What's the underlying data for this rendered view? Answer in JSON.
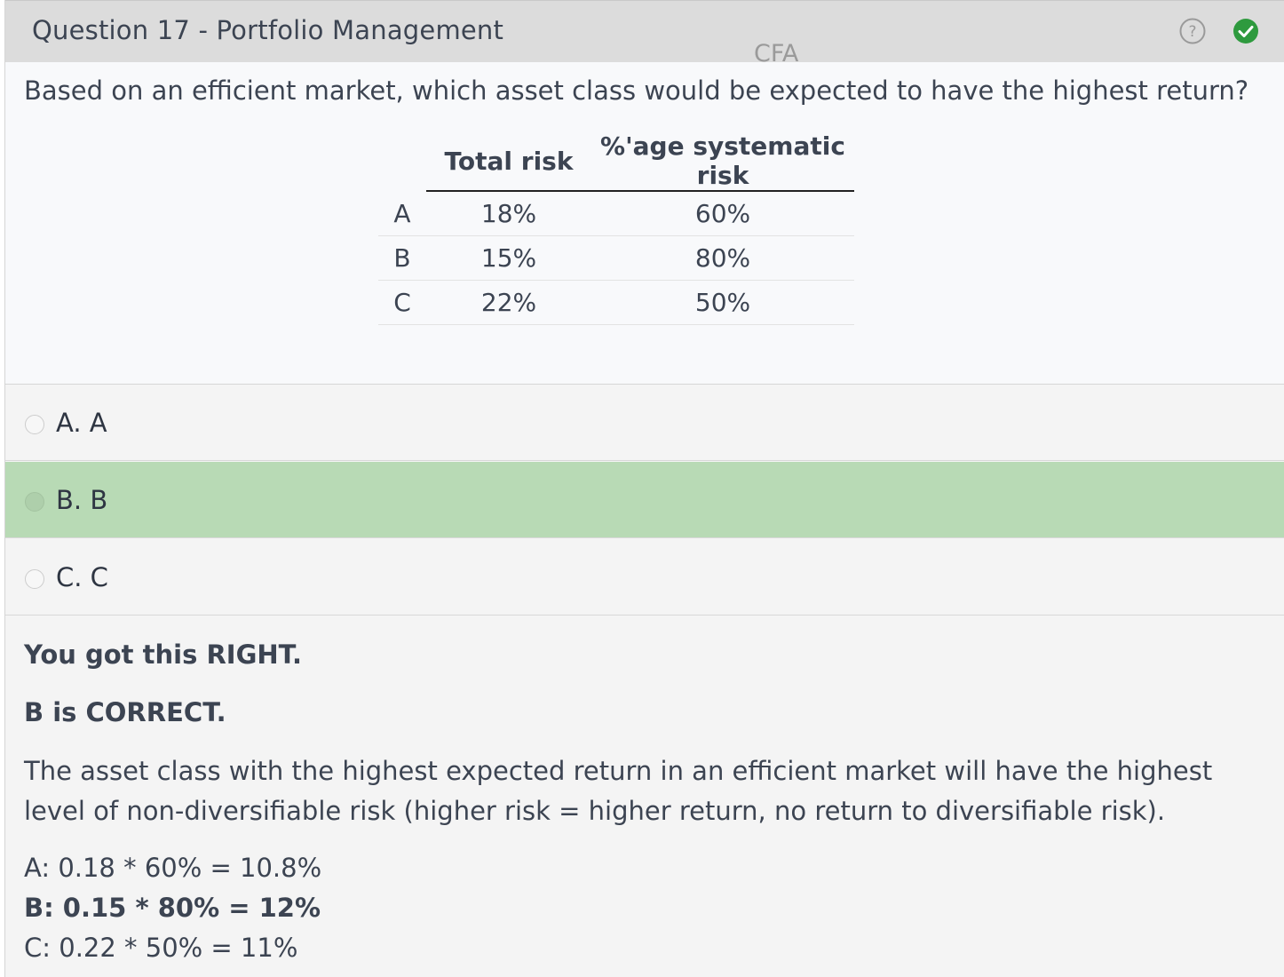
{
  "header": {
    "title": "Question 17 - Portfolio Management",
    "watermark": "CFA",
    "help_icon": "help-circle-icon",
    "status_icon": "check-circle-icon",
    "status_color": "#2e9a3e"
  },
  "question": {
    "text": "Based on an efficient market, which asset class would be expected to have the highest return?",
    "table": {
      "headers": [
        "",
        "Total risk",
        "%'age systematic risk"
      ],
      "rows": [
        [
          "A",
          "18%",
          "60%"
        ],
        [
          "B",
          "15%",
          "80%"
        ],
        [
          "C",
          "22%",
          "50%"
        ]
      ]
    }
  },
  "options": [
    {
      "label": "A. A",
      "selected": false
    },
    {
      "label": "B. B",
      "selected": true
    },
    {
      "label": "C. C",
      "selected": false
    }
  ],
  "feedback": {
    "result": "You got this RIGHT.",
    "correct": "B is CORRECT.",
    "explanation": "The asset class with the highest expected return in an efficient market will have the highest level of non-diversifiable risk (higher risk = higher return, no return to diversifiable risk).",
    "calculations": [
      "A: 0.18 * 60% = 10.8%",
      "B: 0.15 * 80% = 12%",
      "C: 0.22 * 50% = 11%"
    ]
  },
  "colors": {
    "selected_option": "#b8dab5",
    "header_bg": "#dcdcdc"
  }
}
